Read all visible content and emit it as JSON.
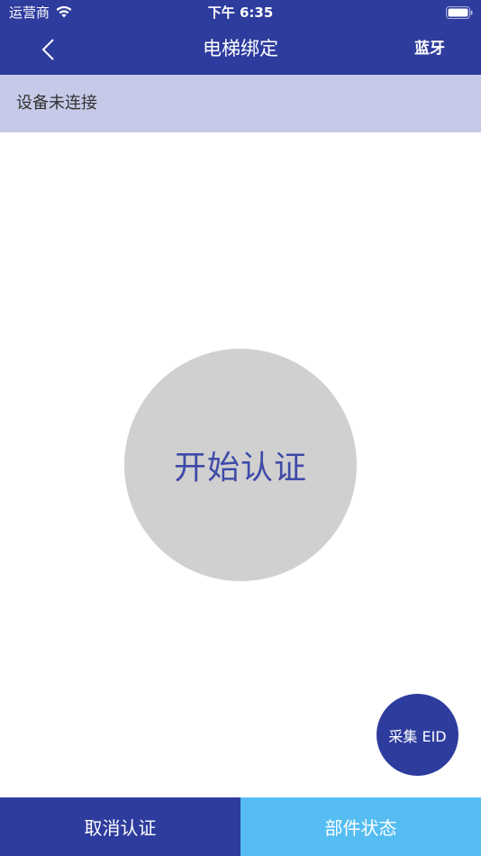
{
  "status_bar": {
    "carrier": "运营商",
    "time": "下午 6:35",
    "icons": [
      "wifi-icon",
      "battery-icon"
    ]
  },
  "nav": {
    "back_icon": "chevron-left-icon",
    "title": "电梯绑定",
    "right_label": "蓝牙"
  },
  "banner": {
    "status_text": "设备未连接"
  },
  "main": {
    "start_auth_label": "开始认证",
    "collect_eid_label": "采集 EID"
  },
  "bottom": {
    "cancel_label": "取消认证",
    "status_label": "部件状态"
  },
  "colors": {
    "primary": "#2e3c9e",
    "banner": "#c6cae8",
    "circle": "#d0d0d0",
    "circle_text": "#3f4aa8",
    "secondary": "#55bdf2"
  }
}
